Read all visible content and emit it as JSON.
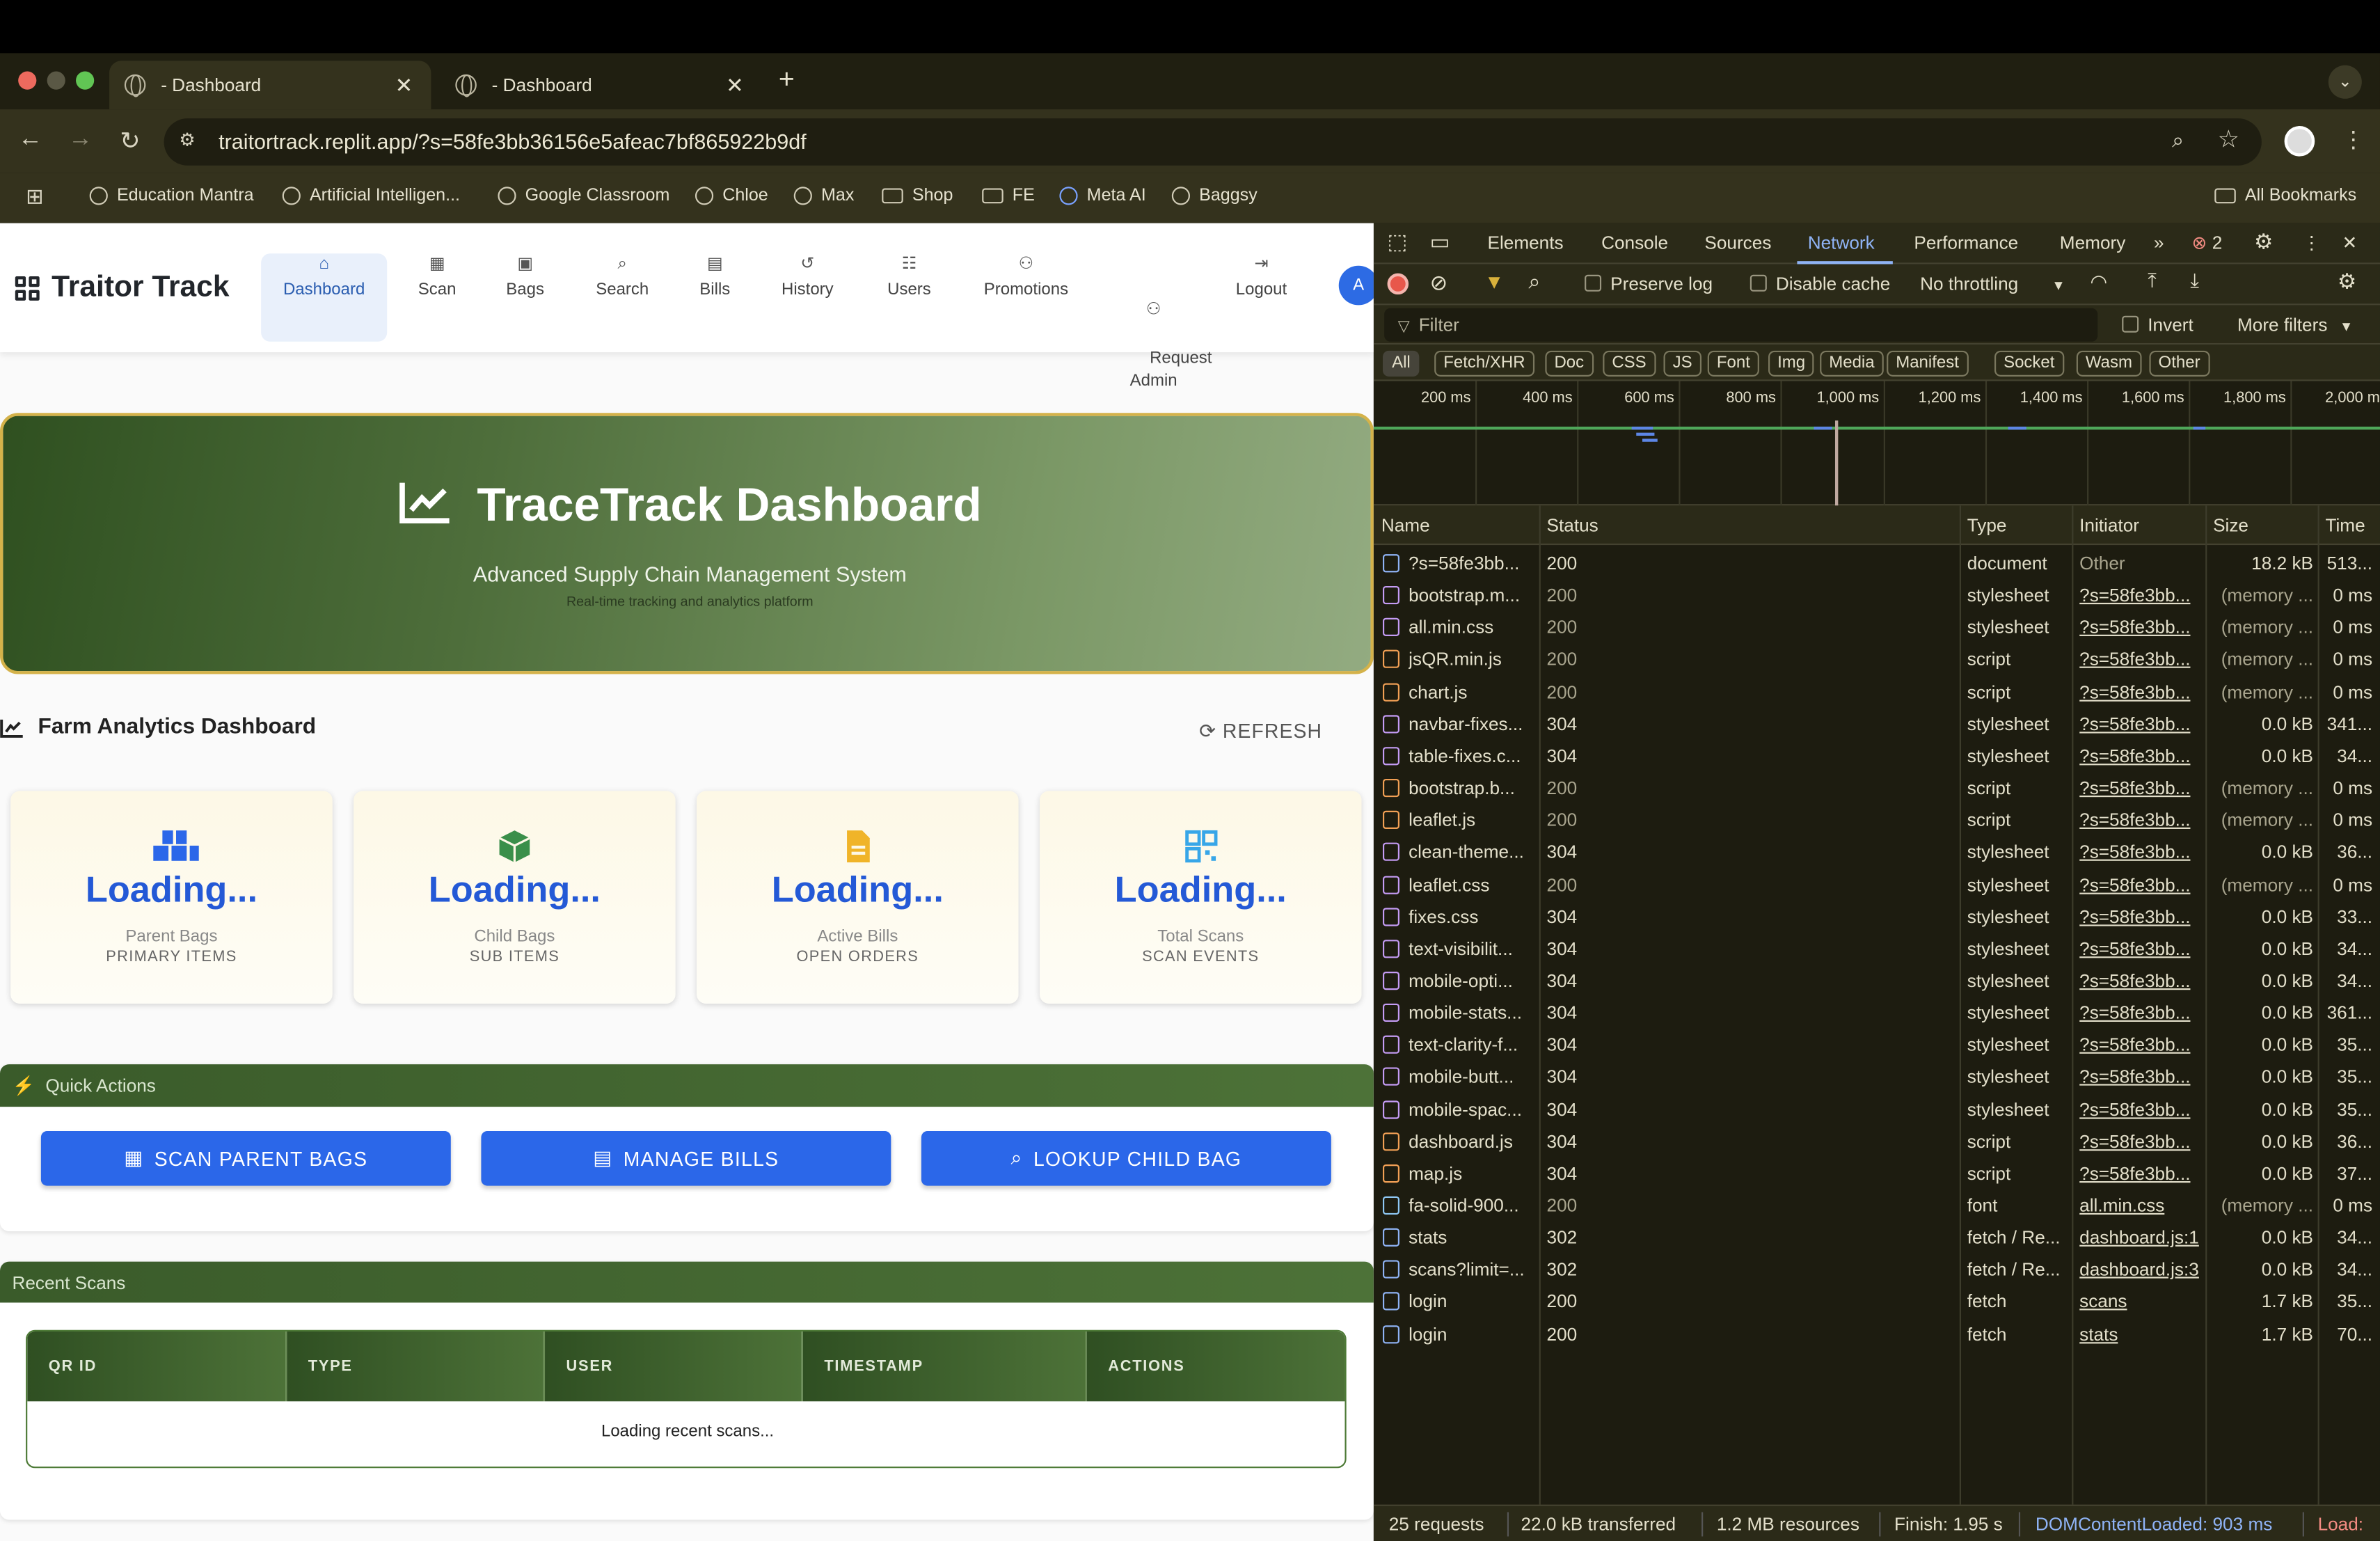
{
  "browser": {
    "tabs": [
      {
        "title": "- Dashboard"
      },
      {
        "title": "- Dashboard"
      }
    ],
    "new_tab": "+",
    "url": "traitortrack.replit.app/?s=58fe3bb36156e5afeac7bf865922b9df",
    "bookmarks": [
      "Education Mantra",
      "Artificial Intelligen...",
      "Google Classroom",
      "Chloe",
      "Max",
      "Shop",
      "FE",
      "Meta AI",
      "Baggsy"
    ],
    "all_bookmarks": "All Bookmarks"
  },
  "app": {
    "brand": "Traitor Track",
    "nav": [
      {
        "label": "Dashboard",
        "icon": "⌂"
      },
      {
        "label": "Scan",
        "icon": "▦"
      },
      {
        "label": "Bags",
        "icon": "▣"
      },
      {
        "label": "Search",
        "icon": "⌕"
      },
      {
        "label": "Bills",
        "icon": "▤"
      },
      {
        "label": "History",
        "icon": "↺"
      },
      {
        "label": "Users",
        "icon": "☷"
      },
      {
        "label": "Promotions",
        "icon": "⚇"
      },
      {
        "label": "Request\nAdmin",
        "icon": "⚇"
      },
      {
        "label": "Logout",
        "icon": "⇥"
      }
    ],
    "avatar": "A",
    "hero": {
      "title": "TraceTrack Dashboard",
      "subtitle": "Advanced Supply Chain Management System",
      "tagline": "Real-time tracking and analytics platform"
    },
    "analytics": {
      "title": "Farm Analytics Dashboard",
      "refresh": "REFRESH"
    },
    "cards": [
      {
        "value": "Loading...",
        "label": "Parent Bags",
        "sub": "PRIMARY ITEMS",
        "icon_color": "#2b67e9"
      },
      {
        "value": "Loading...",
        "label": "Child Bags",
        "sub": "SUB ITEMS",
        "icon_color": "#3a8f4a"
      },
      {
        "value": "Loading...",
        "label": "Active Bills",
        "sub": "OPEN ORDERS",
        "icon_color": "#f0b429"
      },
      {
        "value": "Loading...",
        "label": "Total Scans",
        "sub": "SCAN EVENTS",
        "icon_color": "#37a6e8"
      }
    ],
    "quick_actions": {
      "title": "Quick Actions",
      "buttons": [
        "SCAN PARENT BAGS",
        "MANAGE BILLS",
        "LOOKUP CHILD BAG"
      ]
    },
    "recent_scans": {
      "title": "Recent Scans",
      "columns": [
        "QR ID",
        "TYPE",
        "USER",
        "TIMESTAMP",
        "ACTIONS"
      ],
      "empty": "Loading recent scans..."
    }
  },
  "devtools": {
    "tabs": [
      "Elements",
      "Console",
      "Sources",
      "Network",
      "Performance",
      "Memory"
    ],
    "error_count": "2",
    "preserve_log": "Preserve log",
    "disable_cache": "Disable cache",
    "throttling": "No throttling",
    "filter_placeholder": "Filter",
    "invert": "Invert",
    "more_filters": "More filters",
    "type_filters": [
      "All",
      "Fetch/XHR",
      "Doc",
      "CSS",
      "JS",
      "Font",
      "Img",
      "Media",
      "Manifest",
      "Socket",
      "Wasm",
      "Other"
    ],
    "timeline_ticks": [
      "200 ms",
      "400 ms",
      "600 ms",
      "800 ms",
      "1,000 ms",
      "1,200 ms",
      "1,400 ms",
      "1,600 ms",
      "1,800 ms",
      "2,000 ms"
    ],
    "columns": [
      "Name",
      "Status",
      "Type",
      "Initiator",
      "Size",
      "Time"
    ],
    "requests": [
      {
        "name": "?s=58fe3bb...",
        "status": "200",
        "type": "document",
        "initiator": "Other",
        "size": "18.2 kB",
        "time": "513...",
        "kind": "doc",
        "cached": false
      },
      {
        "name": "bootstrap.m...",
        "status": "200",
        "type": "stylesheet",
        "initiator": "?s=58fe3bb...",
        "size": "(memory ...",
        "time": "0 ms",
        "kind": "css",
        "cached": true
      },
      {
        "name": "all.min.css",
        "status": "200",
        "type": "stylesheet",
        "initiator": "?s=58fe3bb...",
        "size": "(memory ...",
        "time": "0 ms",
        "kind": "css",
        "cached": true
      },
      {
        "name": "jsQR.min.js",
        "status": "200",
        "type": "script",
        "initiator": "?s=58fe3bb...",
        "size": "(memory ...",
        "time": "0 ms",
        "kind": "js",
        "cached": true
      },
      {
        "name": "chart.js",
        "status": "200",
        "type": "script",
        "initiator": "?s=58fe3bb...",
        "size": "(memory ...",
        "time": "0 ms",
        "kind": "js",
        "cached": true
      },
      {
        "name": "navbar-fixes...",
        "status": "304",
        "type": "stylesheet",
        "initiator": "?s=58fe3bb...",
        "size": "0.0 kB",
        "time": "341...",
        "kind": "css",
        "cached": false
      },
      {
        "name": "table-fixes.c...",
        "status": "304",
        "type": "stylesheet",
        "initiator": "?s=58fe3bb...",
        "size": "0.0 kB",
        "time": "34...",
        "kind": "css",
        "cached": false
      },
      {
        "name": "bootstrap.b...",
        "status": "200",
        "type": "script",
        "initiator": "?s=58fe3bb...",
        "size": "(memory ...",
        "time": "0 ms",
        "kind": "js",
        "cached": true
      },
      {
        "name": "leaflet.js",
        "status": "200",
        "type": "script",
        "initiator": "?s=58fe3bb...",
        "size": "(memory ...",
        "time": "0 ms",
        "kind": "js",
        "cached": true
      },
      {
        "name": "clean-theme...",
        "status": "304",
        "type": "stylesheet",
        "initiator": "?s=58fe3bb...",
        "size": "0.0 kB",
        "time": "36...",
        "kind": "css",
        "cached": false
      },
      {
        "name": "leaflet.css",
        "status": "200",
        "type": "stylesheet",
        "initiator": "?s=58fe3bb...",
        "size": "(memory ...",
        "time": "0 ms",
        "kind": "css",
        "cached": true
      },
      {
        "name": "fixes.css",
        "status": "304",
        "type": "stylesheet",
        "initiator": "?s=58fe3bb...",
        "size": "0.0 kB",
        "time": "33...",
        "kind": "css",
        "cached": false
      },
      {
        "name": "text-visibilit...",
        "status": "304",
        "type": "stylesheet",
        "initiator": "?s=58fe3bb...",
        "size": "0.0 kB",
        "time": "34...",
        "kind": "css",
        "cached": false
      },
      {
        "name": "mobile-opti...",
        "status": "304",
        "type": "stylesheet",
        "initiator": "?s=58fe3bb...",
        "size": "0.0 kB",
        "time": "34...",
        "kind": "css",
        "cached": false
      },
      {
        "name": "mobile-stats...",
        "status": "304",
        "type": "stylesheet",
        "initiator": "?s=58fe3bb...",
        "size": "0.0 kB",
        "time": "361...",
        "kind": "css",
        "cached": false
      },
      {
        "name": "text-clarity-f...",
        "status": "304",
        "type": "stylesheet",
        "initiator": "?s=58fe3bb...",
        "size": "0.0 kB",
        "time": "35...",
        "kind": "css",
        "cached": false
      },
      {
        "name": "mobile-butt...",
        "status": "304",
        "type": "stylesheet",
        "initiator": "?s=58fe3bb...",
        "size": "0.0 kB",
        "time": "35...",
        "kind": "css",
        "cached": false
      },
      {
        "name": "mobile-spac...",
        "status": "304",
        "type": "stylesheet",
        "initiator": "?s=58fe3bb...",
        "size": "0.0 kB",
        "time": "35...",
        "kind": "css",
        "cached": false
      },
      {
        "name": "dashboard.js",
        "status": "304",
        "type": "script",
        "initiator": "?s=58fe3bb...",
        "size": "0.0 kB",
        "time": "36...",
        "kind": "js",
        "cached": false
      },
      {
        "name": "map.js",
        "status": "304",
        "type": "script",
        "initiator": "?s=58fe3bb...",
        "size": "0.0 kB",
        "time": "37...",
        "kind": "js",
        "cached": false
      },
      {
        "name": "fa-solid-900...",
        "status": "200",
        "type": "font",
        "initiator": "all.min.css",
        "size": "(memory ...",
        "time": "0 ms",
        "kind": "font",
        "cached": true
      },
      {
        "name": "stats",
        "status": "302",
        "type": "fetch / Re...",
        "initiator": "dashboard.js:1",
        "size": "0.0 kB",
        "time": "34...",
        "kind": "doc",
        "cached": false
      },
      {
        "name": "scans?limit=...",
        "status": "302",
        "type": "fetch / Re...",
        "initiator": "dashboard.js:3",
        "size": "0.0 kB",
        "time": "34...",
        "kind": "doc",
        "cached": false
      },
      {
        "name": "login",
        "status": "200",
        "type": "fetch",
        "initiator": "scans",
        "size": "1.7 kB",
        "time": "35...",
        "kind": "doc",
        "cached": false
      },
      {
        "name": "login",
        "status": "200",
        "type": "fetch",
        "initiator": "stats",
        "size": "1.7 kB",
        "time": "70...",
        "kind": "doc",
        "cached": false
      }
    ],
    "status": {
      "requests": "25 requests",
      "transferred": "22.0 kB transferred",
      "resources": "1.2 MB resources",
      "finish": "Finish: 1.95 s",
      "dcl": "DOMContentLoaded: 903 ms",
      "load": "Load:"
    }
  }
}
